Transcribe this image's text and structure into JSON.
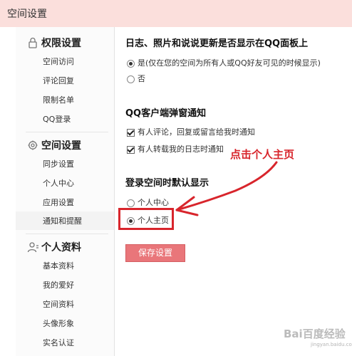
{
  "window": {
    "title": "空间设置"
  },
  "sidebar": {
    "sections": [
      {
        "label": "权限设置",
        "icon": "lock-icon",
        "items": [
          "空间访问",
          "评论回复",
          "限制名单",
          "QQ登录"
        ]
      },
      {
        "label": "空间设置",
        "icon": "gear-icon",
        "items": [
          "同步设置",
          "个人中心",
          "应用设置",
          "通知和提醒"
        ]
      },
      {
        "label": "个人资料",
        "icon": "user-icon",
        "items": [
          "基本资料",
          "我的爱好",
          "空间资料",
          "头像形象",
          "实名认证"
        ]
      }
    ],
    "active_item": "通知和提醒"
  },
  "main": {
    "qq_panel": {
      "heading": "日志、照片和说说更新是否显示在QQ面板上",
      "options": [
        "是(仅在您的空间为所有人或QQ好友可见的时候显示)",
        "否"
      ],
      "selected": "是(仅在您的空间为所有人或QQ好友可见的时候显示)"
    },
    "popup_notice": {
      "heading": "QQ客户端弹窗通知",
      "checkboxes": [
        {
          "label": "有人评论，回复或留言给我时通知",
          "checked": true
        },
        {
          "label": "有人转载我的日志时通知",
          "checked": true
        }
      ]
    },
    "default_display": {
      "heading": "登录空间时默认显示",
      "options": [
        "个人中心",
        "个人主页"
      ],
      "selected": "个人主页"
    },
    "save_label": "保存设置"
  },
  "annotation": {
    "text": "点击个人主页",
    "color": "#d8252c"
  },
  "watermark": {
    "text": "Bai百度经验",
    "sub": "jingyan.baidu.com"
  },
  "colors": {
    "title_bg": "#fbdfdc",
    "save_button": "#e9767a",
    "annotation": "#d8252c"
  }
}
